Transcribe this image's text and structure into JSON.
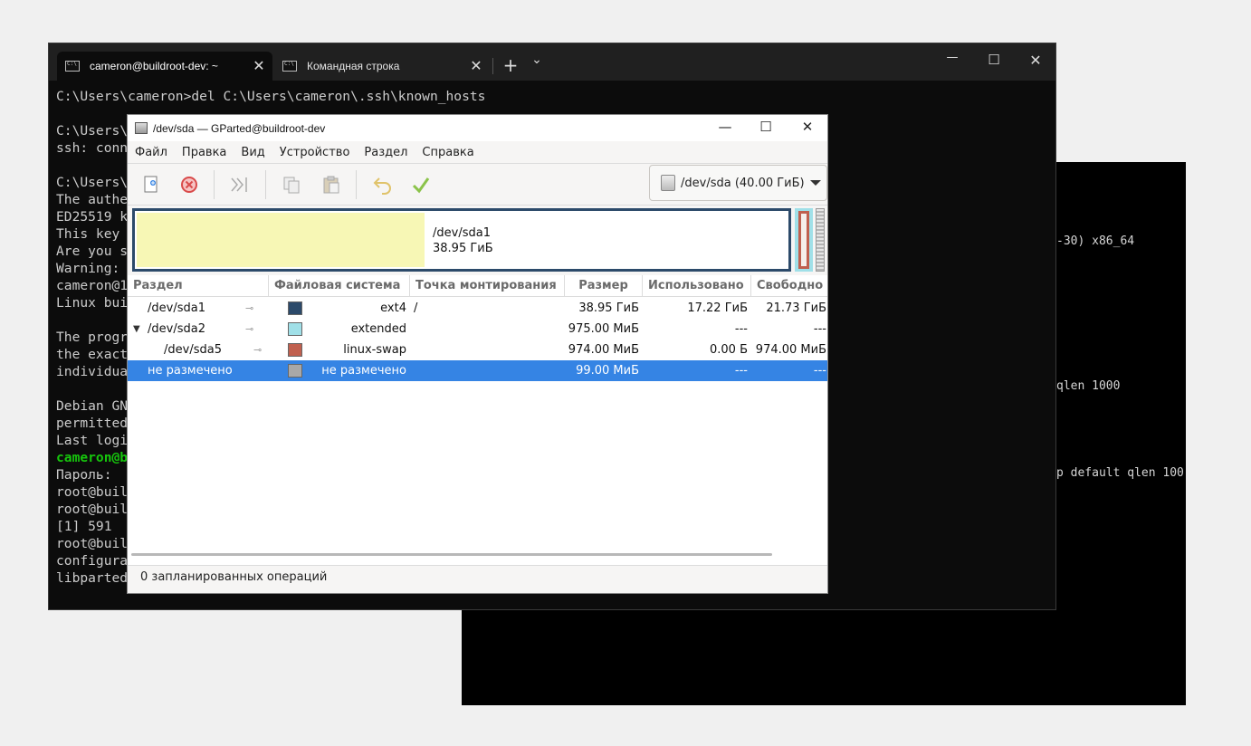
{
  "bg_console": {
    "lines": [
      "-30) x86_64",
      "qlen 1000",
      "p default qlen 100"
    ]
  },
  "terminal": {
    "tabs": [
      {
        "label": "cameron@buildroot-dev: ~"
      },
      {
        "label": "Командная строка"
      }
    ],
    "new_tab": "+",
    "dropdown": "⌄",
    "minimize": "—",
    "maximize": "☐",
    "close": "✕",
    "lines": [
      "C:\\Users\\cameron>del C:\\Users\\cameron\\.ssh\\known_hosts",
      "",
      "C:\\Users\\",
      "ssh: conn",
      "",
      "C:\\Users\\",
      "The authe",
      "ED25519 k",
      "This key",
      "Are you s",
      "Warning: ",
      "cameron@1",
      "Linux bui",
      "",
      "The progr",
      "the exact",
      "individua",
      "",
      "Debian GN",
      "permitted",
      "Last logi",
      "cameron@b",
      "Пароль:",
      "root@buil",
      "root@buil",
      "[1] 591",
      "root@buil",
      "configura",
      "libparted"
    ],
    "green_line_index": 21
  },
  "gparted": {
    "title": "/dev/sda — GParted@buildroot-dev",
    "menu": [
      "Файл",
      "Правка",
      "Вид",
      "Устройство",
      "Раздел",
      "Справка"
    ],
    "device_select": "/dev/sda (40.00 ГиБ)",
    "graph": {
      "sda1_name": "/dev/sda1",
      "sda1_size": "38.95 ГиБ",
      "sda1_used_fraction": 0.44
    },
    "columns": [
      "Раздел",
      "Файловая система",
      "Точка монтирования",
      "Размер",
      "Использовано",
      "Свободно"
    ],
    "rows": [
      {
        "partition": "/dev/sda1",
        "fs": "ext4",
        "mount": "/",
        "size": "38.95 ГиБ",
        "used": "17.22 ГиБ",
        "free": "21.73 ГиБ",
        "color": "#2c4a6a"
      },
      {
        "partition": "/dev/sda2",
        "fs": "extended",
        "mount": "",
        "size": "975.00 МиБ",
        "used": "---",
        "free": "---",
        "color": "#a0e0e8"
      },
      {
        "partition": "/dev/sda5",
        "fs": "linux-swap",
        "mount": "",
        "size": "974.00 МиБ",
        "used": "0.00 Б",
        "free": "974.00 МиБ",
        "color": "#c0604f"
      },
      {
        "partition": "не размечено",
        "fs": "не размечено",
        "mount": "",
        "size": "99.00 МиБ",
        "used": "---",
        "free": "---",
        "color": "#a8a8a8"
      }
    ],
    "status": "0 запланированных операций"
  }
}
